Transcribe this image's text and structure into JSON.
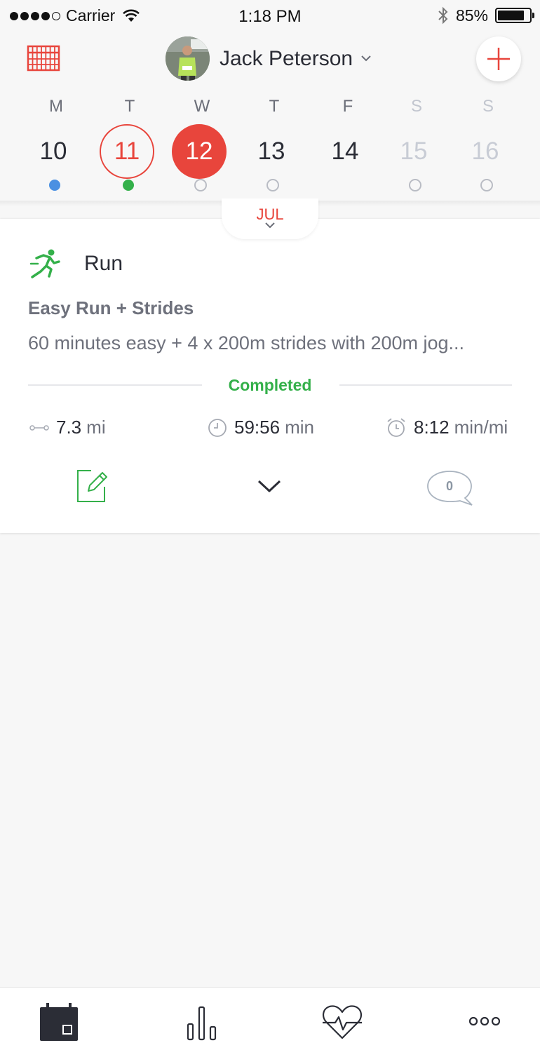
{
  "status_bar": {
    "carrier": "Carrier",
    "time": "1:18 PM",
    "battery": "85%",
    "battery_level": 0.85
  },
  "header": {
    "user_name": "Jack Peterson",
    "accent_color": "#e8453c",
    "weekdays": [
      {
        "label": "M",
        "dim": false
      },
      {
        "label": "T",
        "dim": false
      },
      {
        "label": "W",
        "dim": false
      },
      {
        "label": "T",
        "dim": false
      },
      {
        "label": "F",
        "dim": false
      },
      {
        "label": "S",
        "dim": true
      },
      {
        "label": "S",
        "dim": true
      }
    ],
    "days": [
      {
        "num": "10",
        "state": "normal",
        "dot": "blue"
      },
      {
        "num": "11",
        "state": "selected",
        "dot": "green"
      },
      {
        "num": "12",
        "state": "today",
        "dot": "empty"
      },
      {
        "num": "13",
        "state": "normal",
        "dot": "empty"
      },
      {
        "num": "14",
        "state": "normal",
        "dot": "none"
      },
      {
        "num": "15",
        "state": "future",
        "dot": "empty"
      },
      {
        "num": "16",
        "state": "future",
        "dot": "empty"
      }
    ],
    "month": "JUL"
  },
  "card": {
    "activity": "Run",
    "activity_icon": "runner-icon",
    "workout_title": "Easy Run + Strides",
    "workout_description": "60 minutes easy + 4 x 200m strides with 200m jog...",
    "status": "Completed",
    "status_color": "#34b04a",
    "stats": [
      {
        "icon": "distance-icon",
        "value": "7.3",
        "unit": "mi"
      },
      {
        "icon": "clock-icon",
        "value": "59:56",
        "unit": "min"
      },
      {
        "icon": "alarm-icon",
        "value": "8:12",
        "unit": "min/mi"
      }
    ],
    "comment_count": "0"
  },
  "tabbar": {
    "tabs": [
      "calendar-tab",
      "stats-tab",
      "health-tab",
      "more-tab"
    ]
  }
}
